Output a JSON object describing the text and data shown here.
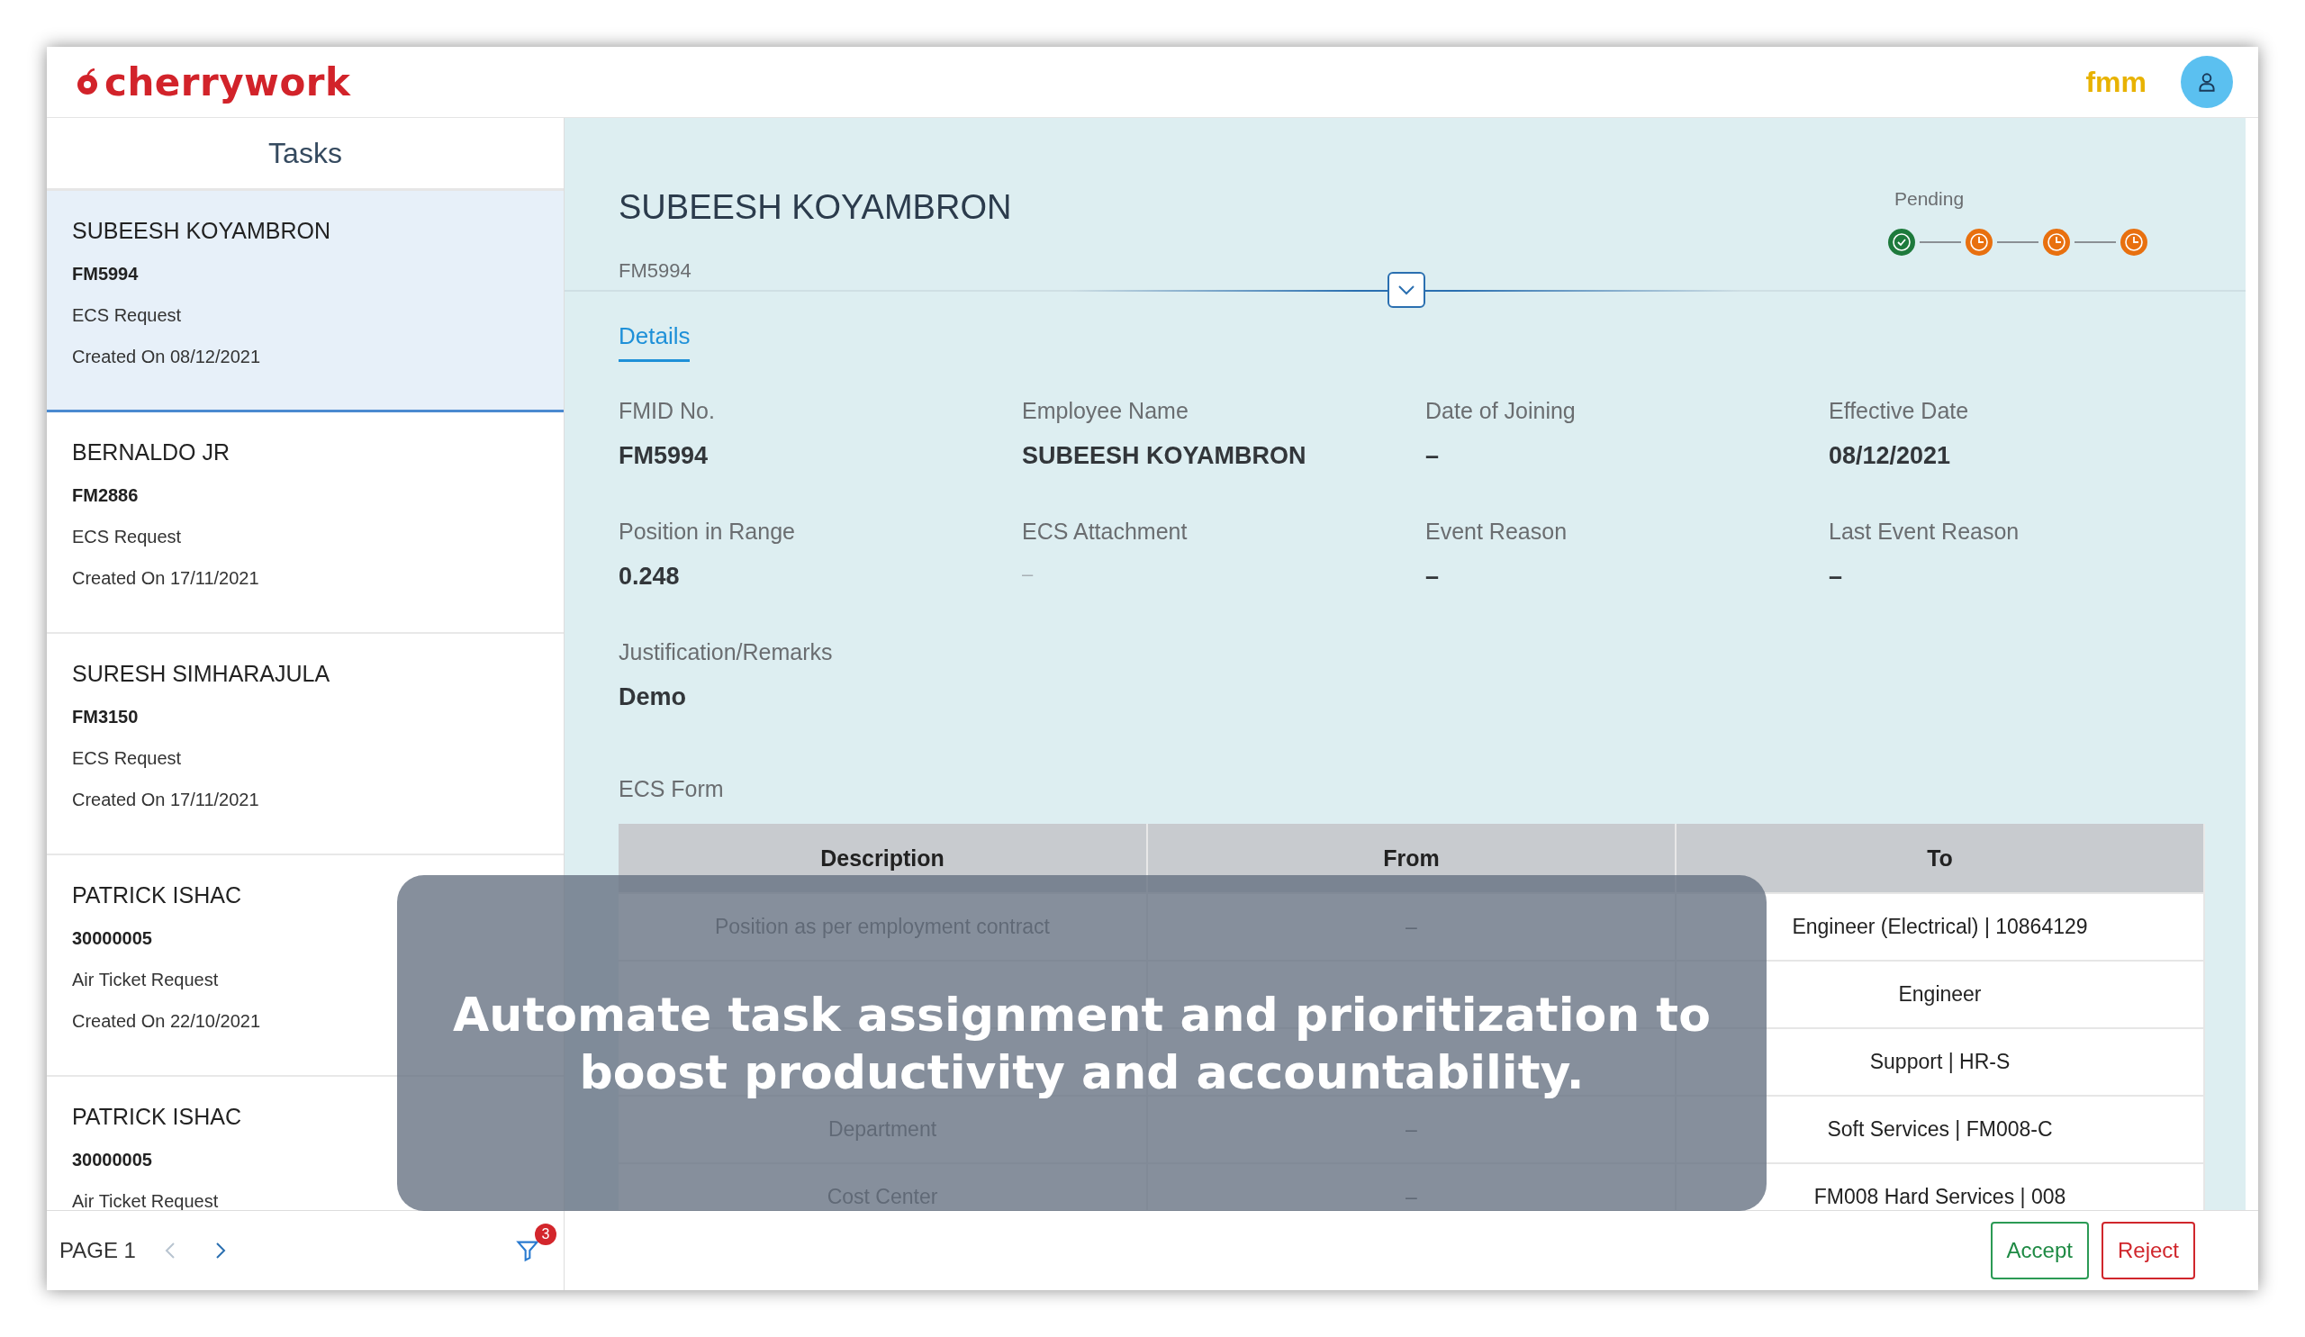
{
  "header": {
    "logo": "cherrywork",
    "partner_logo": "fmm"
  },
  "tasks": {
    "title": "Tasks",
    "items": [
      {
        "name": "SUBEESH KOYAMBRON",
        "id": "FM5994",
        "type": "ECS Request",
        "created": "Created On 08/12/2021",
        "selected": true
      },
      {
        "name": "BERNALDO JR",
        "id": "FM2886",
        "type": "ECS Request",
        "created": "Created On 17/11/2021",
        "selected": false
      },
      {
        "name": "SURESH SIMHARAJULA",
        "id": "FM3150",
        "type": "ECS Request",
        "created": "Created On 17/11/2021",
        "selected": false
      },
      {
        "name": "PATRICK ISHAC",
        "id": "30000005",
        "type": "Air Ticket Request",
        "created": "Created On 22/10/2021",
        "selected": false
      },
      {
        "name": "PATRICK ISHAC",
        "id": "30000005",
        "type": "Air Ticket Request",
        "selected": false
      }
    ],
    "pager": {
      "label": "PAGE 1",
      "prev_disabled": true,
      "next_disabled": false
    },
    "filter_badge": "3"
  },
  "detail": {
    "title": "SUBEESH KOYAMBRON",
    "subtitle": "FM5994",
    "status": "Pending",
    "steps": [
      {
        "kind": "done"
      },
      {
        "kind": "pending"
      },
      {
        "kind": "pending"
      },
      {
        "kind": "pending"
      }
    ],
    "tabs": [
      {
        "label": "Details",
        "selected": true
      }
    ],
    "fields": [
      {
        "label": "FMID No.",
        "value": "FM5994"
      },
      {
        "label": "Employee Name",
        "value": "SUBEESH KOYAMBRON"
      },
      {
        "label": "Date of Joining",
        "value": "–"
      },
      {
        "label": "Effective Date",
        "value": "08/12/2021"
      },
      {
        "label": "Position in Range",
        "value": "0.248"
      },
      {
        "label": "ECS Attachment",
        "value": "–",
        "muted": true
      },
      {
        "label": "Event Reason",
        "value": "–"
      },
      {
        "label": "Last Event Reason",
        "value": "–"
      },
      {
        "label": "Justification/Remarks",
        "value": "Demo"
      }
    ],
    "form_title": "ECS Form",
    "table": {
      "columns": [
        "Description",
        "From",
        "To"
      ],
      "rows": [
        {
          "description": "Position as per employment contract",
          "from": "–",
          "to": "Engineer (Electrical) | 10864129"
        },
        {
          "to": "Engineer"
        },
        {
          "to": "Support | HR-S"
        },
        {
          "description": "Department",
          "from": "–",
          "to": "Soft Services | FM008-C"
        },
        {
          "description": "Cost Center",
          "from": "–",
          "to": "FM008 Hard Services | 008"
        }
      ]
    },
    "actions": [
      {
        "label": "Accept",
        "kind": "accept"
      },
      {
        "label": "Reject",
        "kind": "reject"
      }
    ]
  },
  "caption": "Automate task assignment and prioritization to boost productivity and accountability."
}
